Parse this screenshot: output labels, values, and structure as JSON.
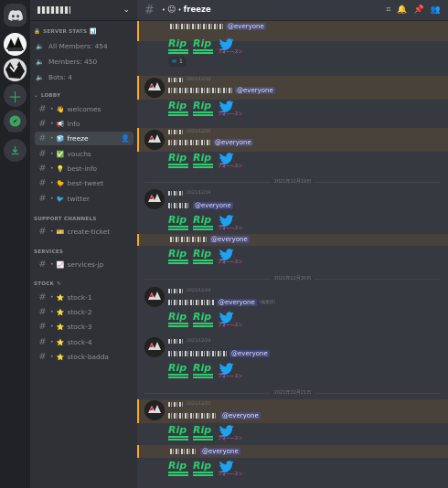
{
  "server": {
    "name_redacted": true
  },
  "guild_rail": {
    "items": [
      {
        "name": "home",
        "icon": "discord-logo-icon"
      },
      {
        "name": "server-1",
        "icon": "server-avatar-icon"
      },
      {
        "name": "server-2",
        "icon": "server-avatar-icon"
      },
      {
        "name": "add-server",
        "icon": "plus-icon"
      },
      {
        "name": "explore",
        "icon": "compass-icon"
      },
      {
        "name": "download",
        "icon": "download-icon"
      }
    ]
  },
  "sidebar": {
    "stats_category": "SERVER STATS",
    "stats": [
      {
        "label": "All Members: 454"
      },
      {
        "label": "Members: 450"
      },
      {
        "label": "Bots: 4"
      }
    ],
    "categories": [
      {
        "label": "LOBBY"
      },
      {
        "label": "SUPPORT CHANNELS"
      },
      {
        "label": "SERVICES"
      },
      {
        "label": "STOCK"
      }
    ],
    "channels": [
      {
        "label": "welcomes",
        "emoji": "👋"
      },
      {
        "label": "info",
        "emoji": "📢"
      },
      {
        "label": "freeze",
        "emoji": "🧊"
      },
      {
        "label": "vouchs",
        "emoji": "✅"
      },
      {
        "label": "best-info",
        "emoji": "💡"
      },
      {
        "label": "best-tweet",
        "emoji": "🐤"
      },
      {
        "label": "twitter",
        "emoji": "🐦"
      },
      {
        "label": "create-ticket",
        "emoji": "🎫"
      },
      {
        "label": "services-jp",
        "emoji": "📈"
      },
      {
        "label": "stock-1",
        "emoji": "⭐"
      },
      {
        "label": "stock-2",
        "emoji": "⭐"
      },
      {
        "label": "stock-3",
        "emoji": "⭐"
      },
      {
        "label": "stock-4",
        "emoji": "⭐"
      },
      {
        "label": "stock-badda",
        "emoji": "⭐"
      }
    ]
  },
  "topbar": {
    "channel": "freeze",
    "emoji": "😐"
  },
  "messages": [
    {
      "mention": "@everyone",
      "reaction_count": "1"
    },
    {
      "time": "2021/12/16",
      "mention": "@everyone"
    },
    {
      "time": "2021/12/16",
      "mention": "@everyone"
    },
    {
      "time": "2021/12/19",
      "mention": "@everyone"
    },
    {
      "mention": "@everyone"
    },
    {
      "time": "2021/12/20",
      "mention": "@everyone",
      "edited": "(編集済)"
    },
    {
      "time": "2021/12/20",
      "mention": "@everyone"
    },
    {
      "time": "2021/12/21",
      "mention": "@everyone"
    },
    {
      "mention": "@everyone"
    }
  ],
  "dividers": [
    "2021年12月19日",
    "2021年12月20日",
    "2021年12月21日"
  ],
  "emoji_text": {
    "rip": "Rip",
    "follow": "フォーースン"
  },
  "colors": {
    "accent": "#5865f2",
    "mention_bg": "#414675",
    "highlight": "#faa81a",
    "username": "#d4344b",
    "rip_green": "#2ecc71"
  }
}
